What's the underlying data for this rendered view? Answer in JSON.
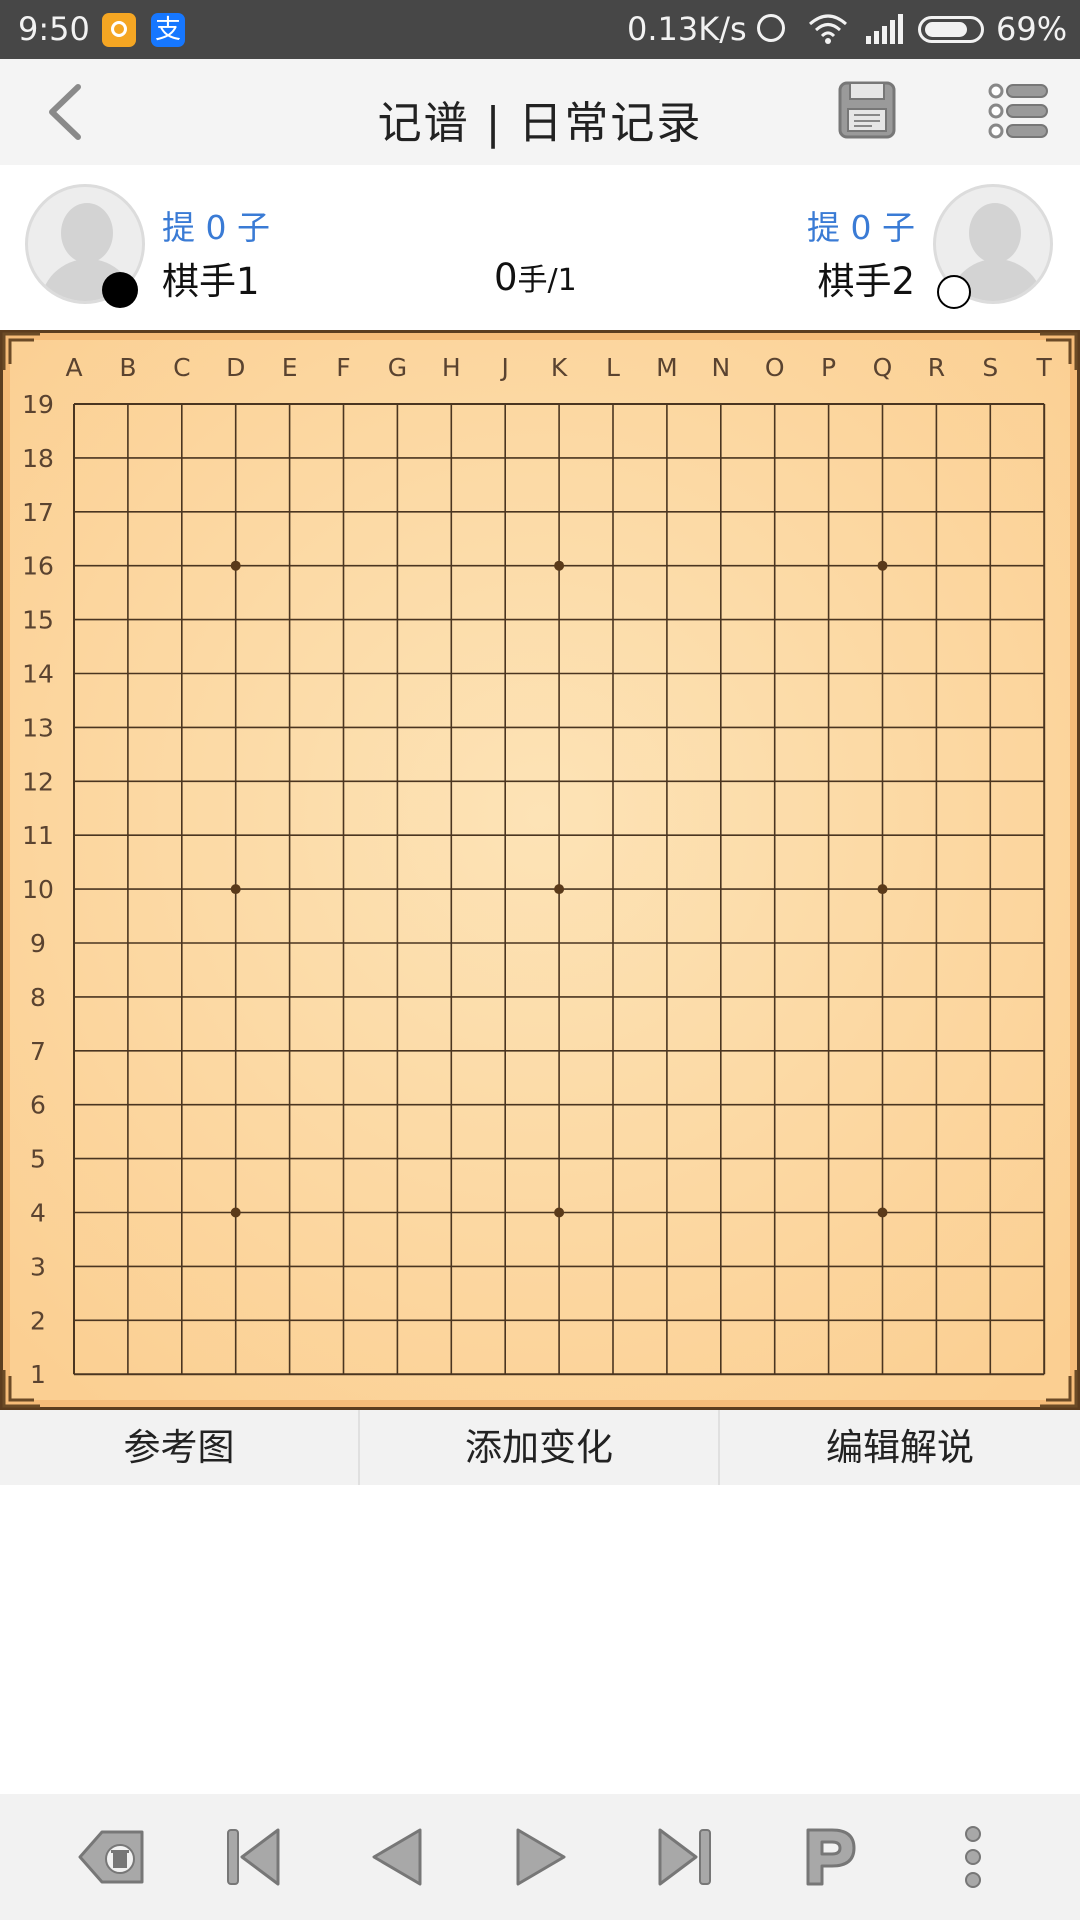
{
  "status_bar": {
    "time": "9:50",
    "alipay_glyph": "支",
    "network_speed": "0.13K/s",
    "battery_percent": "69%"
  },
  "header": {
    "title": "记谱 | 日常记录",
    "icons": [
      "back-chevron-icon",
      "floppy-save-icon",
      "list-menu-icon"
    ]
  },
  "players": {
    "left": {
      "captures": "提 0 子",
      "name": "棋手1",
      "stone": "black"
    },
    "right": {
      "captures": "提 0 子",
      "name": "棋手2",
      "stone": "white"
    },
    "move_count": "0",
    "move_unit": "手/1"
  },
  "board": {
    "size": 19,
    "columns": [
      "A",
      "B",
      "C",
      "D",
      "E",
      "F",
      "G",
      "H",
      "J",
      "K",
      "L",
      "M",
      "N",
      "O",
      "P",
      "Q",
      "R",
      "S",
      "T"
    ],
    "rows": [
      "19",
      "18",
      "17",
      "16",
      "15",
      "14",
      "13",
      "12",
      "11",
      "10",
      "9",
      "8",
      "7",
      "6",
      "5",
      "4",
      "3",
      "2",
      "1"
    ],
    "star_points": [
      "D16",
      "K16",
      "Q16",
      "D10",
      "K10",
      "Q10",
      "D4",
      "K4",
      "Q4"
    ],
    "colors": {
      "wood": "#fcdcaa",
      "frame": "#5c3c1e",
      "line": "#4a3520"
    }
  },
  "tabs": {
    "reference": "参考图",
    "add_variation": "添加变化",
    "edit_comment": "编辑解说"
  },
  "toolbar": {
    "buttons": [
      "undo-delete-icon",
      "first-move-icon",
      "prev-move-icon",
      "next-move-icon",
      "last-move-icon",
      "pass-icon",
      "more-options-icon"
    ]
  },
  "accent_color": "#3a7bd5"
}
